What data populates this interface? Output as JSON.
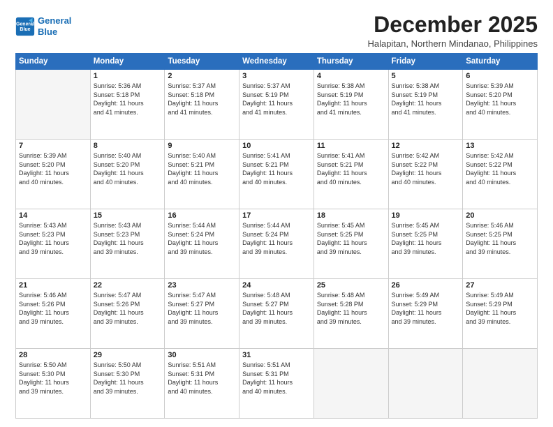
{
  "logo": {
    "line1": "General",
    "line2": "Blue"
  },
  "title": "December 2025",
  "location": "Halapitan, Northern Mindanao, Philippines",
  "days_header": [
    "Sunday",
    "Monday",
    "Tuesday",
    "Wednesday",
    "Thursday",
    "Friday",
    "Saturday"
  ],
  "weeks": [
    [
      {
        "day": "",
        "info": ""
      },
      {
        "day": "1",
        "info": "Sunrise: 5:36 AM\nSunset: 5:18 PM\nDaylight: 11 hours\nand 41 minutes."
      },
      {
        "day": "2",
        "info": "Sunrise: 5:37 AM\nSunset: 5:18 PM\nDaylight: 11 hours\nand 41 minutes."
      },
      {
        "day": "3",
        "info": "Sunrise: 5:37 AM\nSunset: 5:19 PM\nDaylight: 11 hours\nand 41 minutes."
      },
      {
        "day": "4",
        "info": "Sunrise: 5:38 AM\nSunset: 5:19 PM\nDaylight: 11 hours\nand 41 minutes."
      },
      {
        "day": "5",
        "info": "Sunrise: 5:38 AM\nSunset: 5:19 PM\nDaylight: 11 hours\nand 41 minutes."
      },
      {
        "day": "6",
        "info": "Sunrise: 5:39 AM\nSunset: 5:20 PM\nDaylight: 11 hours\nand 40 minutes."
      }
    ],
    [
      {
        "day": "7",
        "info": "Sunrise: 5:39 AM\nSunset: 5:20 PM\nDaylight: 11 hours\nand 40 minutes."
      },
      {
        "day": "8",
        "info": "Sunrise: 5:40 AM\nSunset: 5:20 PM\nDaylight: 11 hours\nand 40 minutes."
      },
      {
        "day": "9",
        "info": "Sunrise: 5:40 AM\nSunset: 5:21 PM\nDaylight: 11 hours\nand 40 minutes."
      },
      {
        "day": "10",
        "info": "Sunrise: 5:41 AM\nSunset: 5:21 PM\nDaylight: 11 hours\nand 40 minutes."
      },
      {
        "day": "11",
        "info": "Sunrise: 5:41 AM\nSunset: 5:21 PM\nDaylight: 11 hours\nand 40 minutes."
      },
      {
        "day": "12",
        "info": "Sunrise: 5:42 AM\nSunset: 5:22 PM\nDaylight: 11 hours\nand 40 minutes."
      },
      {
        "day": "13",
        "info": "Sunrise: 5:42 AM\nSunset: 5:22 PM\nDaylight: 11 hours\nand 40 minutes."
      }
    ],
    [
      {
        "day": "14",
        "info": "Sunrise: 5:43 AM\nSunset: 5:23 PM\nDaylight: 11 hours\nand 39 minutes."
      },
      {
        "day": "15",
        "info": "Sunrise: 5:43 AM\nSunset: 5:23 PM\nDaylight: 11 hours\nand 39 minutes."
      },
      {
        "day": "16",
        "info": "Sunrise: 5:44 AM\nSunset: 5:24 PM\nDaylight: 11 hours\nand 39 minutes."
      },
      {
        "day": "17",
        "info": "Sunrise: 5:44 AM\nSunset: 5:24 PM\nDaylight: 11 hours\nand 39 minutes."
      },
      {
        "day": "18",
        "info": "Sunrise: 5:45 AM\nSunset: 5:25 PM\nDaylight: 11 hours\nand 39 minutes."
      },
      {
        "day": "19",
        "info": "Sunrise: 5:45 AM\nSunset: 5:25 PM\nDaylight: 11 hours\nand 39 minutes."
      },
      {
        "day": "20",
        "info": "Sunrise: 5:46 AM\nSunset: 5:25 PM\nDaylight: 11 hours\nand 39 minutes."
      }
    ],
    [
      {
        "day": "21",
        "info": "Sunrise: 5:46 AM\nSunset: 5:26 PM\nDaylight: 11 hours\nand 39 minutes."
      },
      {
        "day": "22",
        "info": "Sunrise: 5:47 AM\nSunset: 5:26 PM\nDaylight: 11 hours\nand 39 minutes."
      },
      {
        "day": "23",
        "info": "Sunrise: 5:47 AM\nSunset: 5:27 PM\nDaylight: 11 hours\nand 39 minutes."
      },
      {
        "day": "24",
        "info": "Sunrise: 5:48 AM\nSunset: 5:27 PM\nDaylight: 11 hours\nand 39 minutes."
      },
      {
        "day": "25",
        "info": "Sunrise: 5:48 AM\nSunset: 5:28 PM\nDaylight: 11 hours\nand 39 minutes."
      },
      {
        "day": "26",
        "info": "Sunrise: 5:49 AM\nSunset: 5:29 PM\nDaylight: 11 hours\nand 39 minutes."
      },
      {
        "day": "27",
        "info": "Sunrise: 5:49 AM\nSunset: 5:29 PM\nDaylight: 11 hours\nand 39 minutes."
      }
    ],
    [
      {
        "day": "28",
        "info": "Sunrise: 5:50 AM\nSunset: 5:30 PM\nDaylight: 11 hours\nand 39 minutes."
      },
      {
        "day": "29",
        "info": "Sunrise: 5:50 AM\nSunset: 5:30 PM\nDaylight: 11 hours\nand 39 minutes."
      },
      {
        "day": "30",
        "info": "Sunrise: 5:51 AM\nSunset: 5:31 PM\nDaylight: 11 hours\nand 40 minutes."
      },
      {
        "day": "31",
        "info": "Sunrise: 5:51 AM\nSunset: 5:31 PM\nDaylight: 11 hours\nand 40 minutes."
      },
      {
        "day": "",
        "info": ""
      },
      {
        "day": "",
        "info": ""
      },
      {
        "day": "",
        "info": ""
      }
    ]
  ]
}
